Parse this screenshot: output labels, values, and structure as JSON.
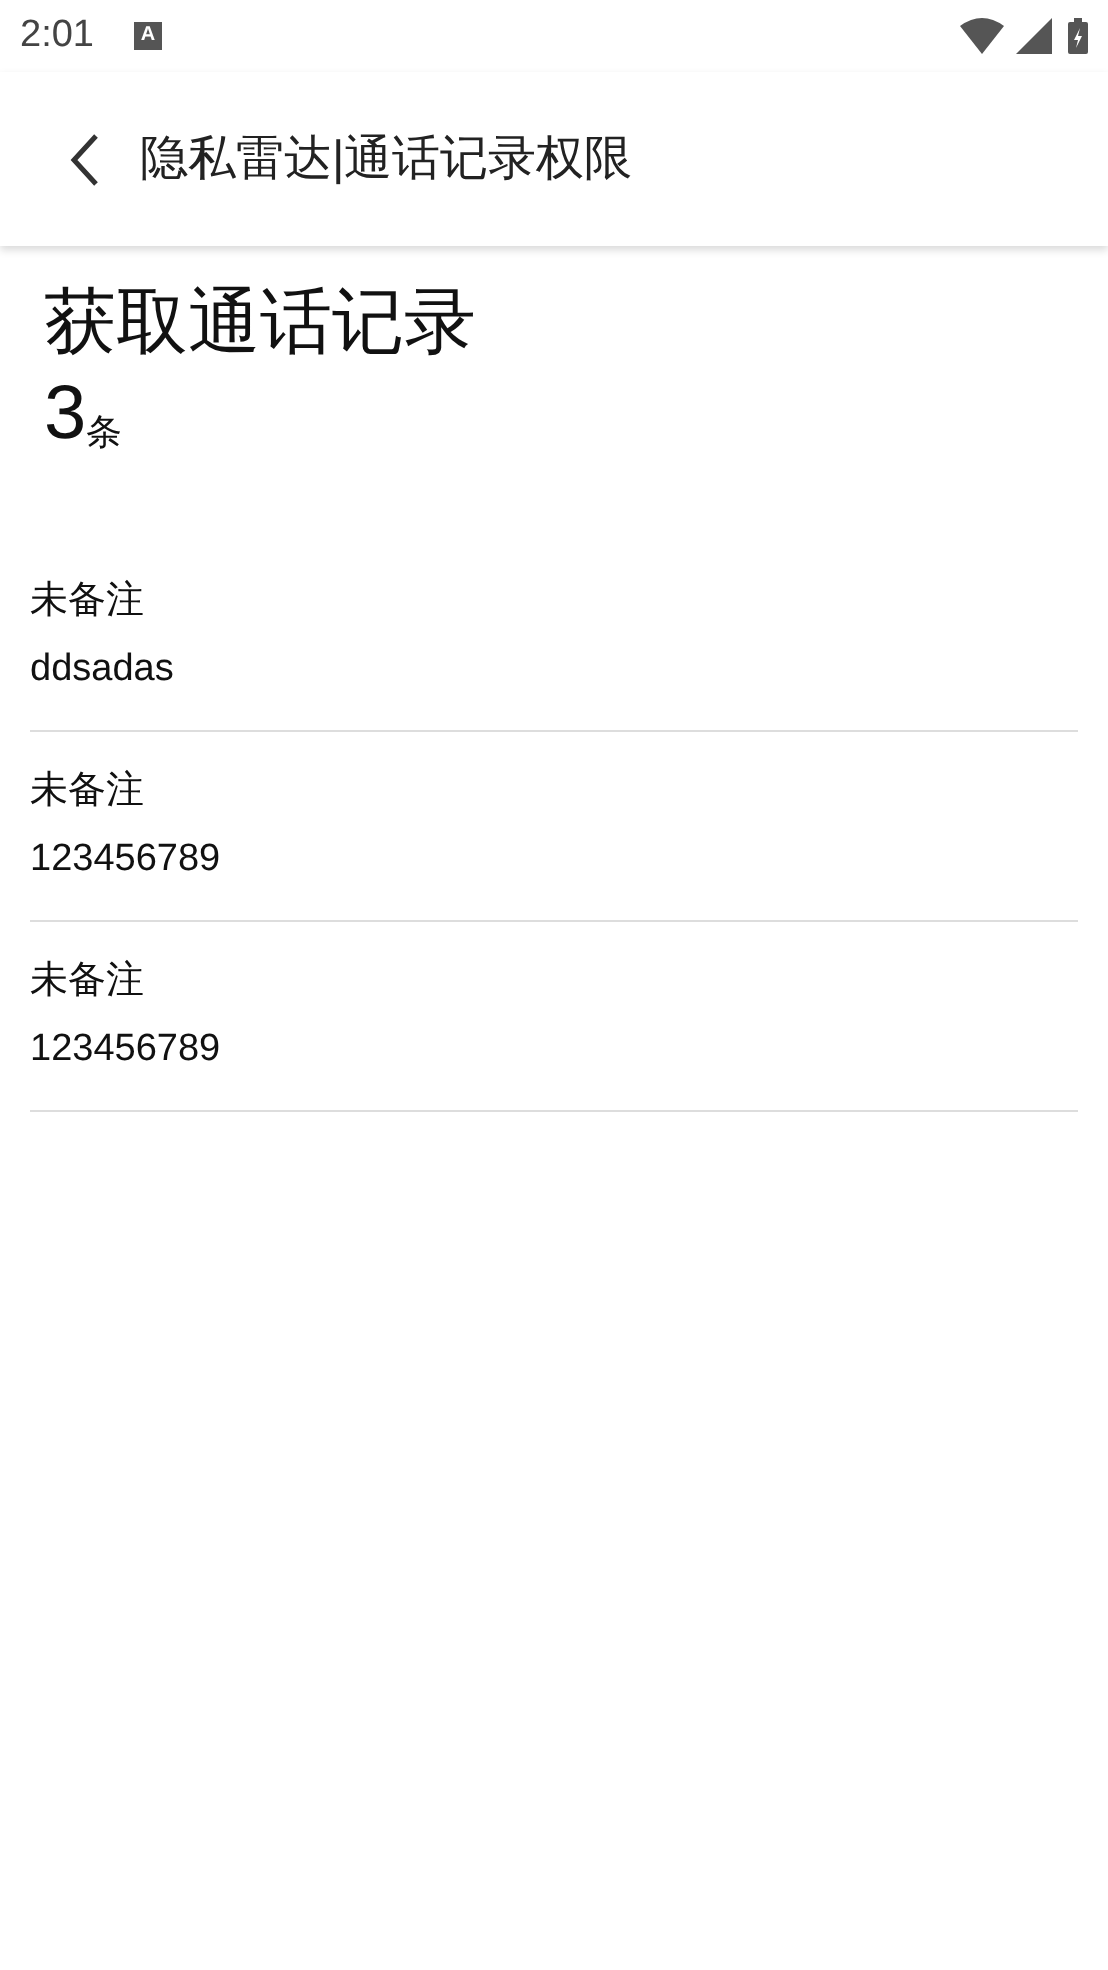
{
  "status_bar": {
    "time": "2:01",
    "notification": "A"
  },
  "header": {
    "title": "隐私雷达|通话记录权限"
  },
  "summary": {
    "title": "获取通话记录",
    "count": "3",
    "unit": "条"
  },
  "records": [
    {
      "name": "未备注",
      "number": "ddsadas"
    },
    {
      "name": "未备注",
      "number": "123456789"
    },
    {
      "name": "未备注",
      "number": "123456789"
    }
  ]
}
